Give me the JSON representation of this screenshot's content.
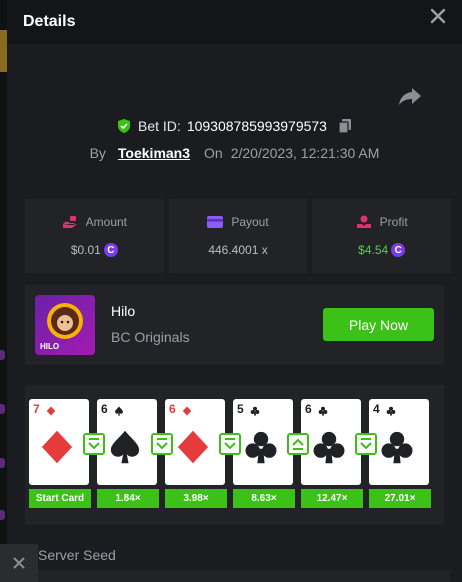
{
  "header": {
    "title": "Details"
  },
  "bet": {
    "id_label": "Bet ID:",
    "id_value": "109308785993979573",
    "by_label": "By",
    "user": "Toekiman3",
    "on_label": "On",
    "datetime": "2/20/2023, 12:21:30 AM"
  },
  "stats": {
    "amount": {
      "label": "Amount",
      "value": "$0.01"
    },
    "payout": {
      "label": "Payout",
      "value": "446.4001 x"
    },
    "profit": {
      "label": "Profit",
      "value": "$4.54"
    }
  },
  "game": {
    "name": "Hilo",
    "provider": "BC Originals",
    "thumb_label": "HILO",
    "play_label": "Play Now"
  },
  "cards": [
    {
      "rank": "7",
      "suit": "diamond",
      "mult": "Start Card",
      "arrow": "none"
    },
    {
      "rank": "6",
      "suit": "spade",
      "mult": "1.84×",
      "arrow": "down"
    },
    {
      "rank": "6",
      "suit": "diamond",
      "mult": "3.98×",
      "arrow": "down"
    },
    {
      "rank": "5",
      "suit": "club",
      "mult": "8.63×",
      "arrow": "down"
    },
    {
      "rank": "6",
      "suit": "club",
      "mult": "12.47×",
      "arrow": "up"
    },
    {
      "rank": "4",
      "suit": "club",
      "mult": "27.01×",
      "arrow": "down"
    }
  ],
  "seed": {
    "label": "Server Seed"
  },
  "colors": {
    "accent": "#3bc117",
    "coin": "#7c3aed",
    "amount_icon": "#e0306f",
    "payout_icon": "#8b5cf6",
    "profit_icon": "#e0306f"
  }
}
